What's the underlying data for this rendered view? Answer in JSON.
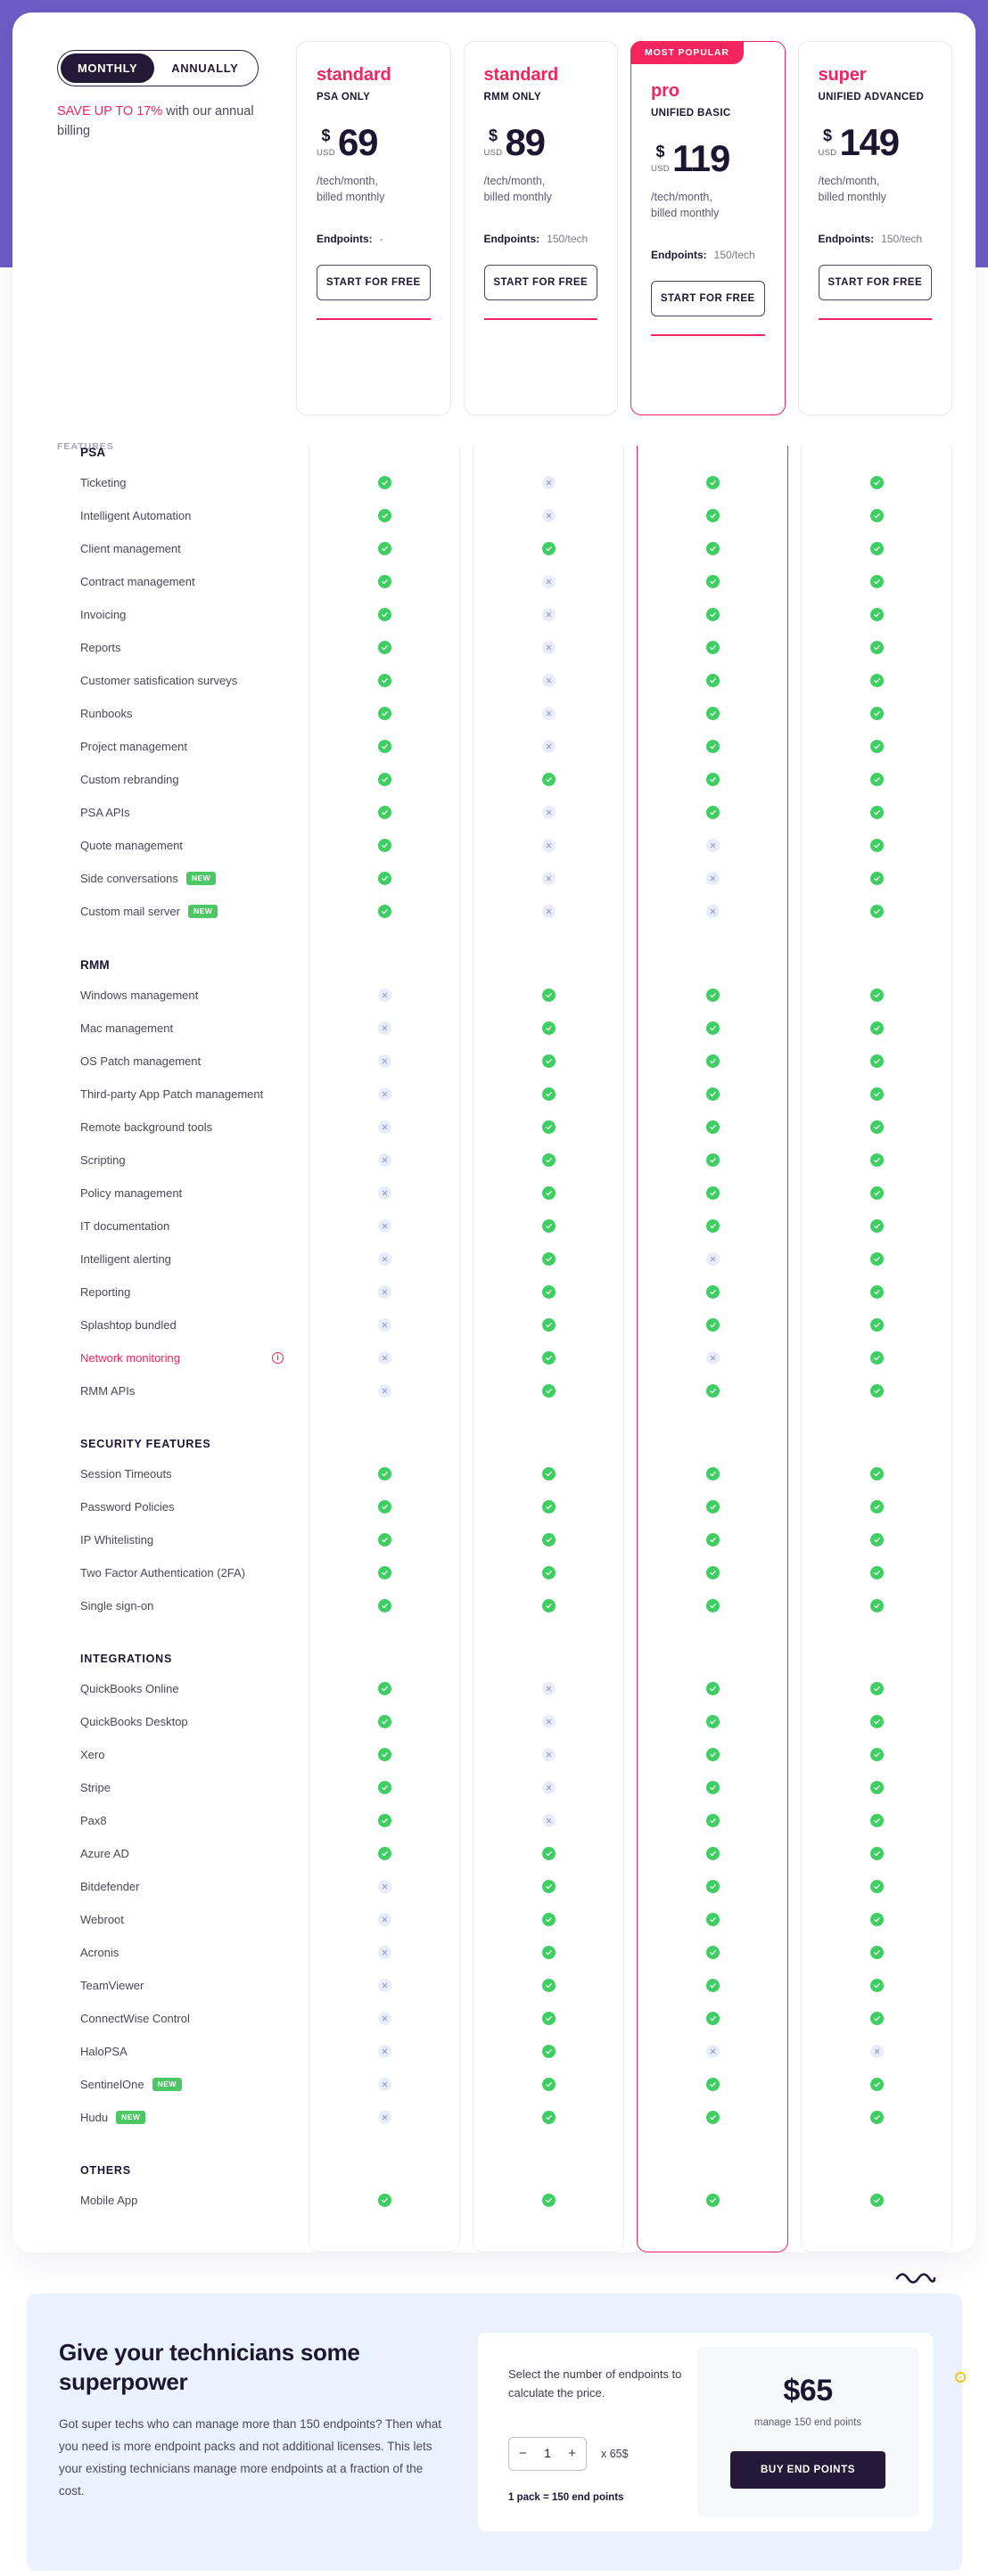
{
  "billing": {
    "monthly_label": "MONTHLY",
    "annually_label": "ANNUALLY",
    "active": "MONTHLY",
    "save_highlight": "SAVE UP TO 17%",
    "save_rest": " with our annual billing"
  },
  "features_label": "FEATURES",
  "colors": {
    "accent_pink": "#f4245e",
    "purple_band": "#6c5cc4",
    "check_green": "#3ece63",
    "cross_bg": "#e9ecfb",
    "dark": "#241a38",
    "bottom_bg": "#eaf3fd"
  },
  "plans": [
    {
      "name": "standard",
      "subtitle": "PSA ONLY",
      "currency_symbol": "$",
      "currency_code": "USD",
      "price": "69",
      "price_note": "/tech/month,\nbilled monthly",
      "endpoints_label": "Endpoints:",
      "endpoints_value": "-",
      "cta": "START FOR FREE",
      "badge": null,
      "featured": false
    },
    {
      "name": "standard",
      "subtitle": "RMM ONLY",
      "currency_symbol": "$",
      "currency_code": "USD",
      "price": "89",
      "price_note": "/tech/month,\nbilled monthly",
      "endpoints_label": "Endpoints:",
      "endpoints_value": "150/tech",
      "cta": "START FOR FREE",
      "badge": null,
      "featured": false
    },
    {
      "name": "pro",
      "subtitle": "UNIFIED BASIC",
      "currency_symbol": "$",
      "currency_code": "USD",
      "price": "119",
      "price_note": "/tech/month,\nbilled monthly",
      "endpoints_label": "Endpoints:",
      "endpoints_value": "150/tech",
      "cta": "START FOR FREE",
      "badge": "MOST POPULAR",
      "featured": true
    },
    {
      "name": "super",
      "subtitle": "UNIFIED ADVANCED",
      "currency_symbol": "$",
      "currency_code": "USD",
      "price": "149",
      "price_note": "/tech/month,\nbilled monthly",
      "endpoints_label": "Endpoints:",
      "endpoints_value": "150/tech",
      "cta": "START FOR FREE",
      "badge": null,
      "featured": false
    }
  ],
  "sections": [
    {
      "title": "PSA",
      "caps": false,
      "rows": [
        {
          "label": "Ticketing",
          "values": [
            true,
            false,
            true,
            true
          ]
        },
        {
          "label": "Intelligent Automation",
          "values": [
            true,
            false,
            true,
            true
          ]
        },
        {
          "label": "Client management",
          "values": [
            true,
            true,
            true,
            true
          ]
        },
        {
          "label": "Contract management",
          "values": [
            true,
            false,
            true,
            true
          ]
        },
        {
          "label": "Invoicing",
          "values": [
            true,
            false,
            true,
            true
          ]
        },
        {
          "label": "Reports",
          "values": [
            true,
            false,
            true,
            true
          ]
        },
        {
          "label": "Customer satisfication surveys",
          "values": [
            true,
            false,
            true,
            true
          ]
        },
        {
          "label": "Runbooks",
          "values": [
            true,
            false,
            true,
            true
          ]
        },
        {
          "label": "Project management",
          "values": [
            true,
            false,
            true,
            true
          ]
        },
        {
          "label": "Custom rebranding",
          "values": [
            true,
            true,
            true,
            true
          ]
        },
        {
          "label": "PSA APIs",
          "values": [
            true,
            false,
            true,
            true
          ]
        },
        {
          "label": "Quote management",
          "values": [
            true,
            false,
            false,
            true
          ]
        },
        {
          "label": "Side conversations",
          "values": [
            true,
            false,
            false,
            true
          ],
          "badge": "NEW"
        },
        {
          "label": "Custom mail server",
          "values": [
            true,
            false,
            false,
            true
          ],
          "badge": "NEW"
        }
      ]
    },
    {
      "title": "RMM",
      "caps": false,
      "rows": [
        {
          "label": "Windows management",
          "values": [
            false,
            true,
            true,
            true
          ]
        },
        {
          "label": "Mac management",
          "values": [
            false,
            true,
            true,
            true
          ]
        },
        {
          "label": "OS Patch management",
          "values": [
            false,
            true,
            true,
            true
          ]
        },
        {
          "label": "Third-party App Patch management",
          "values": [
            false,
            true,
            true,
            true
          ]
        },
        {
          "label": "Remote background tools",
          "values": [
            false,
            true,
            true,
            true
          ]
        },
        {
          "label": "Scripting",
          "values": [
            false,
            true,
            true,
            true
          ]
        },
        {
          "label": "Policy management",
          "values": [
            false,
            true,
            true,
            true
          ]
        },
        {
          "label": "IT documentation",
          "values": [
            false,
            true,
            true,
            true
          ]
        },
        {
          "label": "Intelligent alerting",
          "values": [
            false,
            true,
            false,
            true
          ]
        },
        {
          "label": "Reporting",
          "values": [
            false,
            true,
            true,
            true
          ]
        },
        {
          "label": "Splashtop bundled",
          "values": [
            false,
            true,
            true,
            true
          ]
        },
        {
          "label": "Network monitoring",
          "values": [
            false,
            true,
            false,
            true
          ],
          "pink": true,
          "info": true
        },
        {
          "label": "RMM APIs",
          "values": [
            false,
            true,
            true,
            true
          ]
        }
      ]
    },
    {
      "title": "SECURITY FEATURES",
      "caps": true,
      "rows": [
        {
          "label": "Session Timeouts",
          "values": [
            true,
            true,
            true,
            true
          ]
        },
        {
          "label": "Password Policies",
          "values": [
            true,
            true,
            true,
            true
          ]
        },
        {
          "label": "IP Whitelisting",
          "values": [
            true,
            true,
            true,
            true
          ]
        },
        {
          "label": "Two Factor Authentication (2FA)",
          "values": [
            true,
            true,
            true,
            true
          ]
        },
        {
          "label": "Single sign-on",
          "values": [
            true,
            true,
            true,
            true
          ]
        }
      ]
    },
    {
      "title": "INTEGRATIONS",
      "caps": true,
      "rows": [
        {
          "label": "QuickBooks Online",
          "values": [
            true,
            false,
            true,
            true
          ]
        },
        {
          "label": "QuickBooks Desktop",
          "values": [
            true,
            false,
            true,
            true
          ]
        },
        {
          "label": "Xero",
          "values": [
            true,
            false,
            true,
            true
          ]
        },
        {
          "label": "Stripe",
          "values": [
            true,
            false,
            true,
            true
          ]
        },
        {
          "label": "Pax8",
          "values": [
            true,
            false,
            true,
            true
          ]
        },
        {
          "label": "Azure AD",
          "values": [
            true,
            true,
            true,
            true
          ]
        },
        {
          "label": "Bitdefender",
          "values": [
            false,
            true,
            true,
            true
          ]
        },
        {
          "label": "Webroot",
          "values": [
            false,
            true,
            true,
            true
          ]
        },
        {
          "label": "Acronis",
          "values": [
            false,
            true,
            true,
            true
          ]
        },
        {
          "label": "TeamViewer",
          "values": [
            false,
            true,
            true,
            true
          ]
        },
        {
          "label": "ConnectWise Control",
          "values": [
            false,
            true,
            true,
            true
          ]
        },
        {
          "label": "HaloPSA",
          "values": [
            false,
            true,
            false,
            false
          ]
        },
        {
          "label": "SentinelOne",
          "values": [
            false,
            true,
            true,
            true
          ],
          "badge": "NEW"
        },
        {
          "label": "Hudu",
          "values": [
            false,
            true,
            true,
            true
          ],
          "badge": "NEW"
        }
      ]
    },
    {
      "title": "OTHERS",
      "caps": true,
      "rows": [
        {
          "label": "Mobile App",
          "values": [
            true,
            true,
            true,
            true
          ]
        }
      ]
    }
  ],
  "endpoint_packs": {
    "title": "Give your technicians some superpower",
    "body": "Got super techs who can manage more than 150 endpoints? Then what you need is more endpoint packs and not additional licenses. This lets your existing technicians manage more endpoints at a fraction of the cost.",
    "prompt": "Select the number of endpoints to calculate the price.",
    "decrement": "−",
    "quantity": "1",
    "increment": "+",
    "multiplier": "x 65$",
    "pack_note": "1 pack = 150 end points",
    "price": "$65",
    "price_sub": "manage 150 end points",
    "buy_label": "BUY END POINTS"
  }
}
